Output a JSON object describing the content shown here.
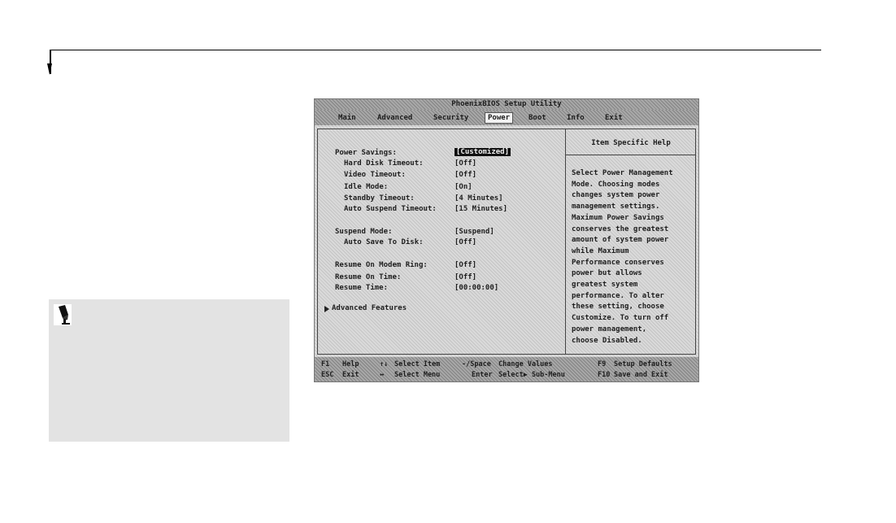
{
  "bios": {
    "title": "PhoenixBIOS Setup Utility",
    "menu": [
      "Main",
      "Advanced",
      "Security",
      "Power",
      "Boot",
      "Info",
      "Exit"
    ],
    "active_menu": "Power",
    "settings": [
      {
        "label": "Power Savings:",
        "value": "[Customized]"
      },
      {
        "label": "Hard Disk Timeout:",
        "value": "[Off]"
      },
      {
        "label": "Video Timeout:",
        "value": "[Off]"
      },
      {
        "label": "Idle Mode:",
        "value": "[On]"
      },
      {
        "label": "Standby Timeout:",
        "value": "[4 Minutes]"
      },
      {
        "label": "Auto Suspend Timeout:",
        "value": "[15 Minutes]"
      },
      {
        "label": "Suspend Mode:",
        "value": "[Suspend]"
      },
      {
        "label": "Auto Save To Disk:",
        "value": "[Off]"
      },
      {
        "label": "Resume On Modem Ring:",
        "value": "[Off]"
      },
      {
        "label": "Resume On Time:",
        "value": "[Off]"
      },
      {
        "label": "Resume Time:",
        "value": "[00:00:00]"
      }
    ],
    "submenu": "Advanced Features",
    "help": {
      "title": "Item Specific Help",
      "lines": [
        "Select Power Management",
        "Mode. Choosing modes",
        "changes system power",
        "management settings.",
        "Maximum Power Savings",
        "conserves the greatest",
        "amount of system power",
        "while Maximum",
        "Performance conserves",
        "power but allows",
        "greatest system",
        "performance. To alter",
        "these setting, choose",
        "Customize. To turn off",
        "power management,",
        "choose Disabled."
      ]
    },
    "footer": {
      "row1": [
        {
          "key": "F1",
          "desc": "Help"
        },
        {
          "key": "↑↓",
          "desc": "Select Item"
        },
        {
          "key": "-/Space",
          "desc": "Change Values"
        },
        {
          "key": "F9",
          "desc": "Setup Defaults"
        }
      ],
      "row2": [
        {
          "key": "ESC",
          "desc": "Exit"
        },
        {
          "key": "↔",
          "desc": "Select Menu"
        },
        {
          "key": "Enter",
          "desc": "Select▶ Sub-Menu"
        },
        {
          "key": "F10",
          "desc": "Save and Exit"
        }
      ]
    }
  },
  "note": {
    "icon": "pen-icon"
  }
}
